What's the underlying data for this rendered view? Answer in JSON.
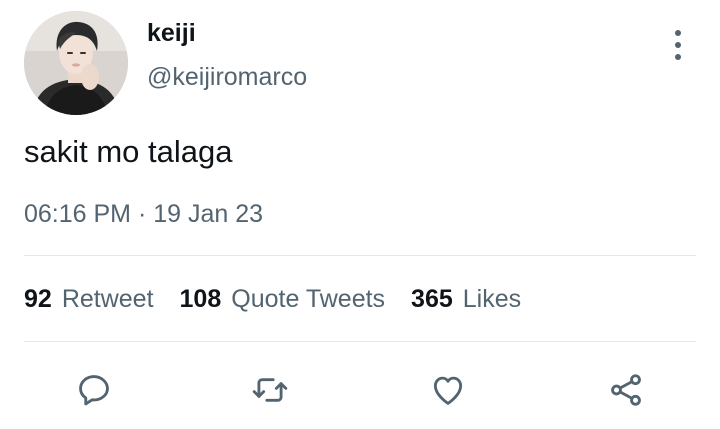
{
  "tweet": {
    "author": {
      "display_name": "keiji",
      "handle": "@keijiromarco"
    },
    "text": "sakit mo talaga",
    "meta": "06:16 PM · 19 Jan 23"
  },
  "stats": {
    "retweets": {
      "count": "92",
      "label": "Retweet"
    },
    "quotes": {
      "count": "108",
      "label": "Quote Tweets"
    },
    "likes": {
      "count": "365",
      "label": "Likes"
    }
  },
  "actions": {
    "reply": "reply-icon",
    "retweet": "retweet-icon",
    "like": "heart-icon",
    "share": "share-icon"
  },
  "colors": {
    "primary_text": "#0f1419",
    "secondary_text": "#536471",
    "divider": "#e1e8ed"
  }
}
